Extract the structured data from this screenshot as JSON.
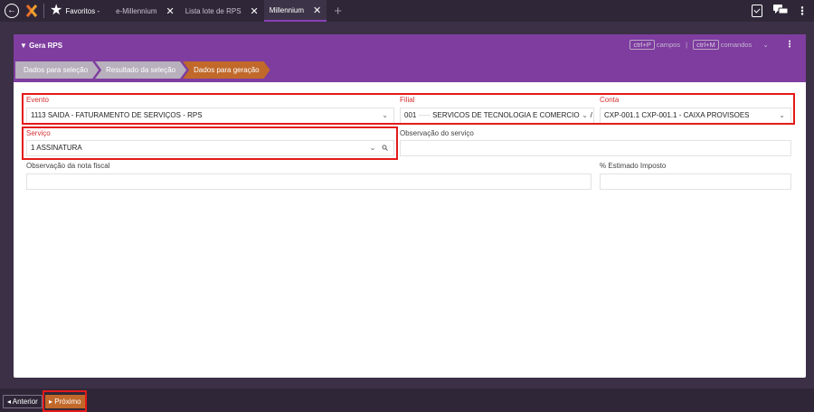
{
  "topbar": {
    "favorites_label": "Favoritos -",
    "tabs": [
      {
        "label": "e-Millennium"
      },
      {
        "label": "Lista lote de RPS"
      },
      {
        "label": "Millennium"
      }
    ],
    "close_glyph": "✕",
    "plus_glyph": "+",
    "kebab_glyph": "⋮"
  },
  "panel": {
    "title": "Gera RPS",
    "hotkeys": {
      "key1": "ctrl+P",
      "label1": "campos",
      "pipe": "|",
      "key2": "ctrl+M",
      "label2": "comandos",
      "chevron": "⌄"
    },
    "steps": [
      "Dados para seleção",
      "Resultado da seleção",
      "Dados para geração"
    ]
  },
  "form": {
    "evento": {
      "label": "Evento",
      "value": "1113 SAIDA - FATURAMENTO DE SERVIÇOS - RPS"
    },
    "filial": {
      "label": "Filial",
      "value_code": "001",
      "value_dash": "-----",
      "value_name": "SERVICOS DE TECNOLOGIA E COMERCIO S. /"
    },
    "conta": {
      "label": "Conta",
      "value": "CXP-001.1 CXP-001.1 - CAIXA PROVISOES"
    },
    "servico": {
      "label": "Serviço",
      "value": "1 ASSINATURA"
    },
    "obs_servico": {
      "label": "Observação do serviço",
      "value": ""
    },
    "obs_nota": {
      "label": "Observação da nota fiscal",
      "value": ""
    },
    "estimado": {
      "label": "% Estimado Imposto",
      "value": ""
    }
  },
  "footer": {
    "prev_label": "Anterior",
    "next_label": "Próximo"
  },
  "colors": {
    "header_purple": "#7e3d9f",
    "step_current": "#c1692a",
    "highlight_red": "#e31a1a"
  }
}
